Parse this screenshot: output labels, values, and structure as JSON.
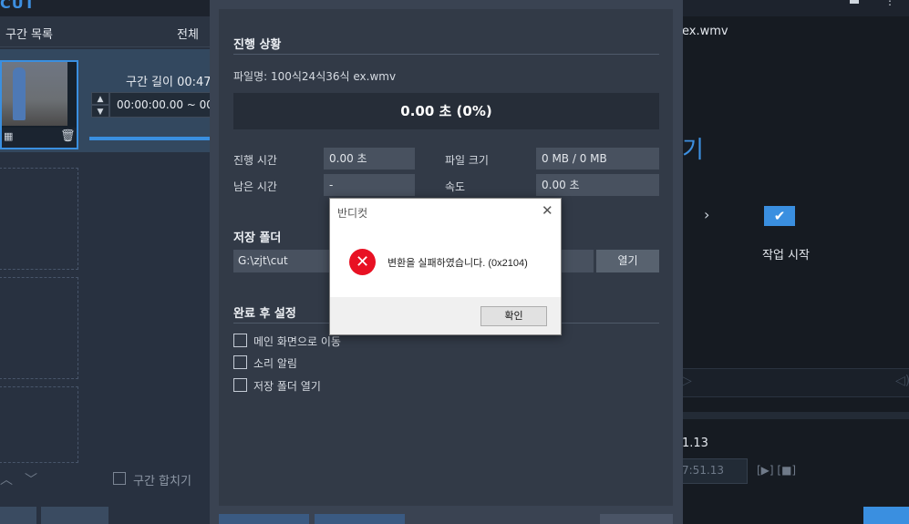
{
  "left": {
    "logo": "CUT",
    "list_title": "구간 목록",
    "list_all": "전체 ",
    "clip_length": "구간 길이 00:47",
    "clip_range": "00:00:00.00 ~ 00:",
    "merge_label": "구간 합치기"
  },
  "modal": {
    "progress_title": "진행 상황",
    "filename": "파일명:  100식24식36식 ex.wmv",
    "progress_value": "0.00 초 (0%)",
    "progress_fraction": 0,
    "elapsed_label": "진행 시간",
    "elapsed_value": "0.00 초",
    "remaining_label": "남은 시간",
    "remaining_value": "-",
    "filesize_label": "파일 크기",
    "filesize_value": "0 MB / 0 MB",
    "speed_label": "속도",
    "speed_value": "0.00 초",
    "folder_title": "저장 폴더",
    "folder_path": "G:\\zjt\\cut",
    "open_folder": "열기",
    "after_title": "완료 후 설정",
    "opt_main": "메인 화면으로 이동",
    "opt_sound": "소리 알림",
    "opt_open_folder": "저장 폴더 열기"
  },
  "dialog": {
    "title": "반디컷",
    "message": "변환을 실패하였습니다. (0x2104)",
    "ok_label": "확인"
  },
  "right": {
    "file": "ex.wmv",
    "open_text": "기",
    "start_label": "작업 시작",
    "time1": "1.13",
    "time2": "7:51.13",
    "controls": "[▶] [■]"
  },
  "colors": {
    "accent": "#3a8fe0",
    "error": "#e81123",
    "modal_bg": "#323a47"
  }
}
